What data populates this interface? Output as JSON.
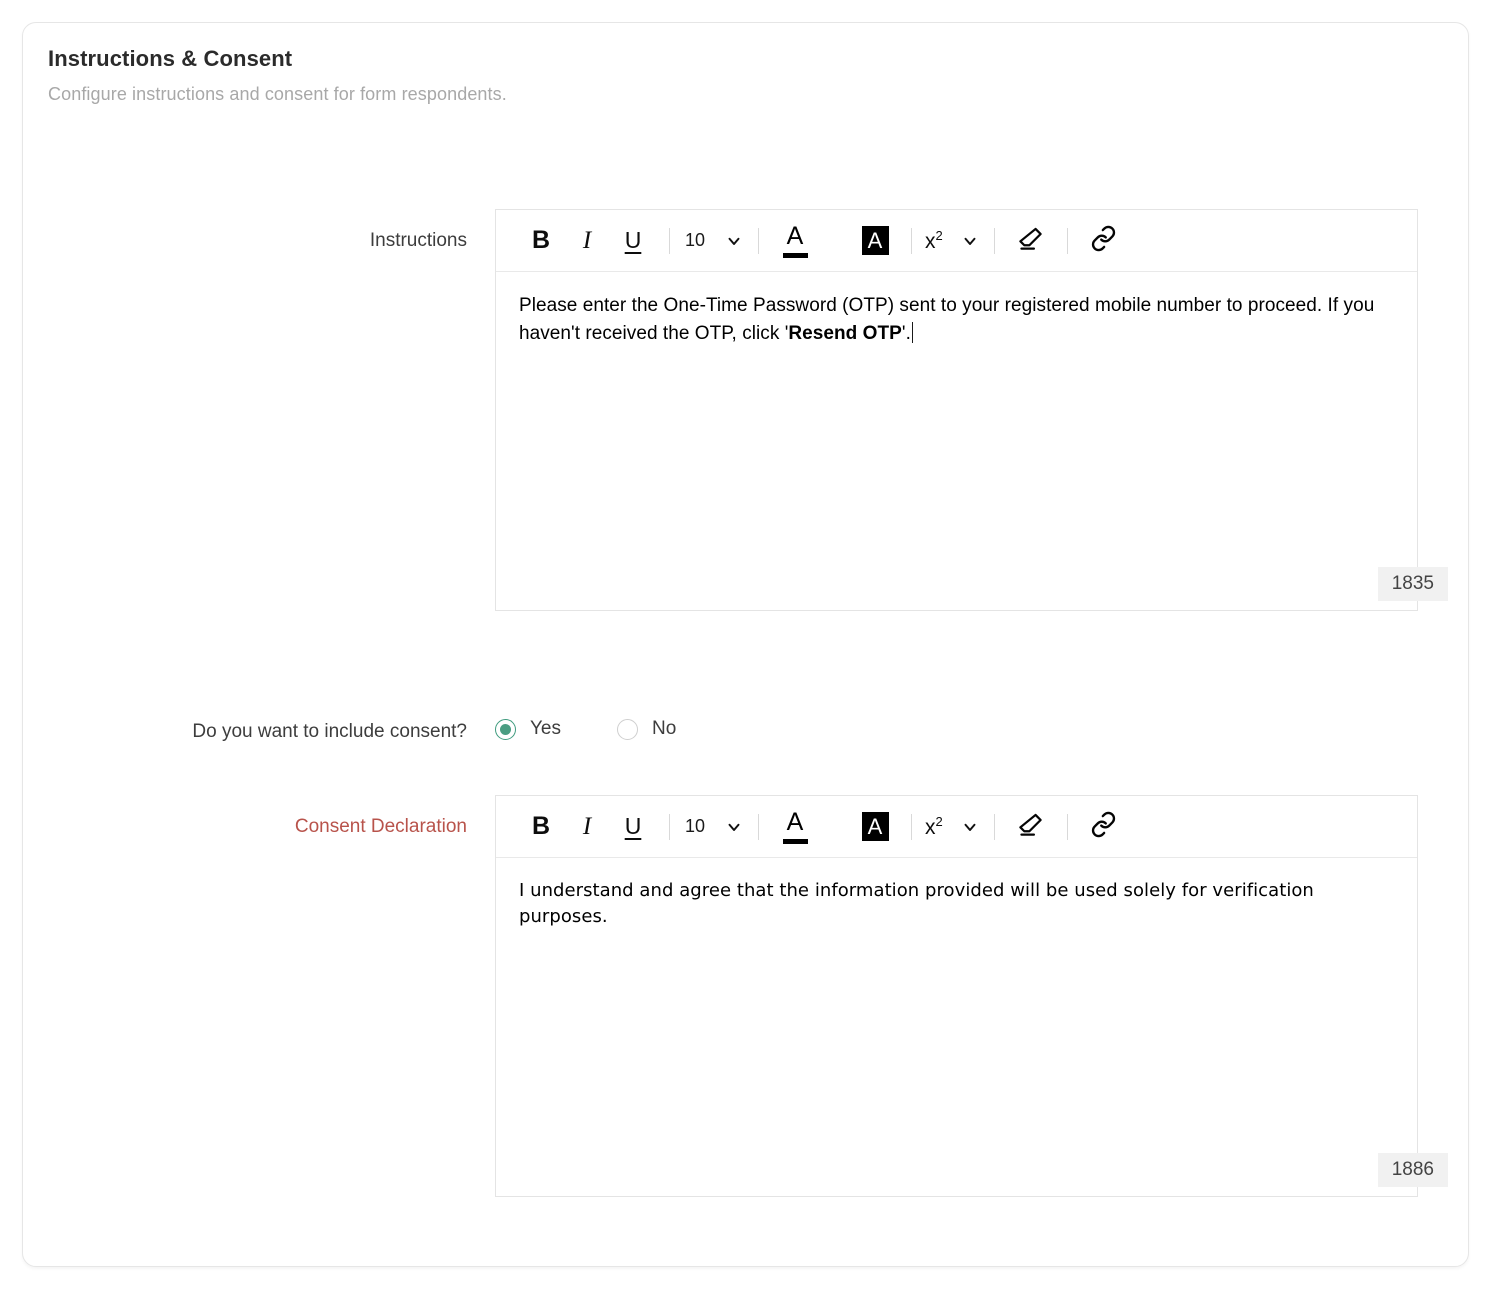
{
  "card": {
    "title": "Instructions & Consent",
    "subtitle": "Configure instructions and consent for form respondents."
  },
  "colors": {
    "accent_radio": "#4a9d82",
    "required_label": "#b8534b",
    "card_border": "#e6e6e6",
    "counter_bg": "#f1f1f1"
  },
  "toolbar": {
    "bold_label": "B",
    "italic_label": "I",
    "underline_label": "U",
    "font_size_value": "10",
    "text_color_glyph": "A",
    "highlight_glyph": "A",
    "superscript_label": "x",
    "superscript_exponent": "2",
    "icons": {
      "chevron": "chevron-down-icon",
      "eraser": "eraser-icon",
      "link": "link-icon"
    }
  },
  "instructions_field": {
    "label": "Instructions",
    "text_before_bold": "Please enter the One-Time Password (OTP) sent to your registered mobile number to proceed. If you haven't received the OTP, click '",
    "text_bold": "Resend OTP",
    "text_after_bold": "'.",
    "char_count": "1835"
  },
  "consent_question": {
    "label": "Do you want to include consent?",
    "options": [
      {
        "label": "Yes",
        "checked": true
      },
      {
        "label": "No",
        "checked": false
      }
    ]
  },
  "declaration_field": {
    "label": "Consent Declaration",
    "required": true,
    "text": "I understand and agree that the information provided will be used solely for verification purposes.",
    "char_count": "1886"
  }
}
